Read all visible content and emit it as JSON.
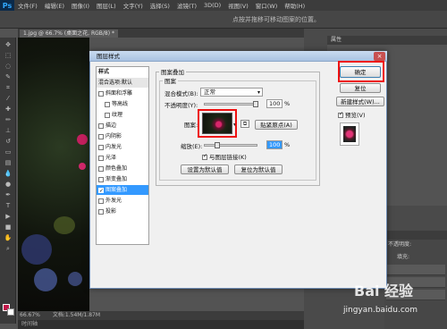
{
  "app": {
    "logo": "Ps"
  },
  "menubar": {
    "items": [
      "文件(F)",
      "编辑(E)",
      "图像(I)",
      "图层(L)",
      "文字(Y)",
      "选择(S)",
      "滤镜(T)",
      "3D(D)",
      "视图(V)",
      "窗口(W)",
      "帮助(H)"
    ]
  },
  "options_bar": {
    "hint": "点按并拖移可移动图案的位置。"
  },
  "document": {
    "tab_title": "1.jpg @ 66.7% (桌面之花, RGB/8) *",
    "zoom": "66.67%",
    "file_info": "文档:1.54M/1.87M",
    "timeline": "时间轴"
  },
  "panels": {
    "properties_title": "属性",
    "layers_opacity_label": "不透明度:",
    "layers_fill_label": "填充:"
  },
  "dialog": {
    "title": "图层样式",
    "close": "×",
    "styles_header": "样式",
    "blend_options": "混合选项:默认",
    "style_items": [
      {
        "label": "斜面和浮雕",
        "checked": false,
        "indent": false
      },
      {
        "label": "等高线",
        "checked": false,
        "indent": true
      },
      {
        "label": "纹理",
        "checked": false,
        "indent": true
      },
      {
        "label": "描边",
        "checked": false,
        "indent": false
      },
      {
        "label": "内阴影",
        "checked": false,
        "indent": false
      },
      {
        "label": "内发光",
        "checked": false,
        "indent": false
      },
      {
        "label": "光泽",
        "checked": false,
        "indent": false
      },
      {
        "label": "颜色叠加",
        "checked": false,
        "indent": false
      },
      {
        "label": "渐变叠加",
        "checked": false,
        "indent": false
      },
      {
        "label": "图案叠加",
        "checked": true,
        "indent": false,
        "selected": true
      },
      {
        "label": "外发光",
        "checked": false,
        "indent": false
      },
      {
        "label": "投影",
        "checked": false,
        "indent": false
      }
    ],
    "group_title": "图案叠加",
    "subgroup_title": "图案",
    "blend_mode_label": "混合模式(B):",
    "blend_mode_value": "正常",
    "opacity_label": "不透明度(Y):",
    "opacity_value": "100",
    "opacity_unit": "%",
    "pattern_label": "图案:",
    "snap_origin_btn": "贴紧原点(A)",
    "scale_label": "缩放(E):",
    "scale_value": "100",
    "scale_unit": "%",
    "link_layer_label": "与图层链接(K)",
    "link_layer_checked": true,
    "set_default_btn": "设置为默认值",
    "reset_default_btn": "复位为默认值",
    "ok_btn": "确定",
    "cancel_btn": "复位",
    "new_style_btn": "新建样式(W)...",
    "preview_label": "预览(V)",
    "preview_checked": true
  },
  "watermark": {
    "main": "Bai 经验",
    "sub": "jingyan.baidu.com"
  },
  "colors": {
    "highlight": "#e11111",
    "selection": "#3399ff",
    "foreground": "#c2174a"
  }
}
